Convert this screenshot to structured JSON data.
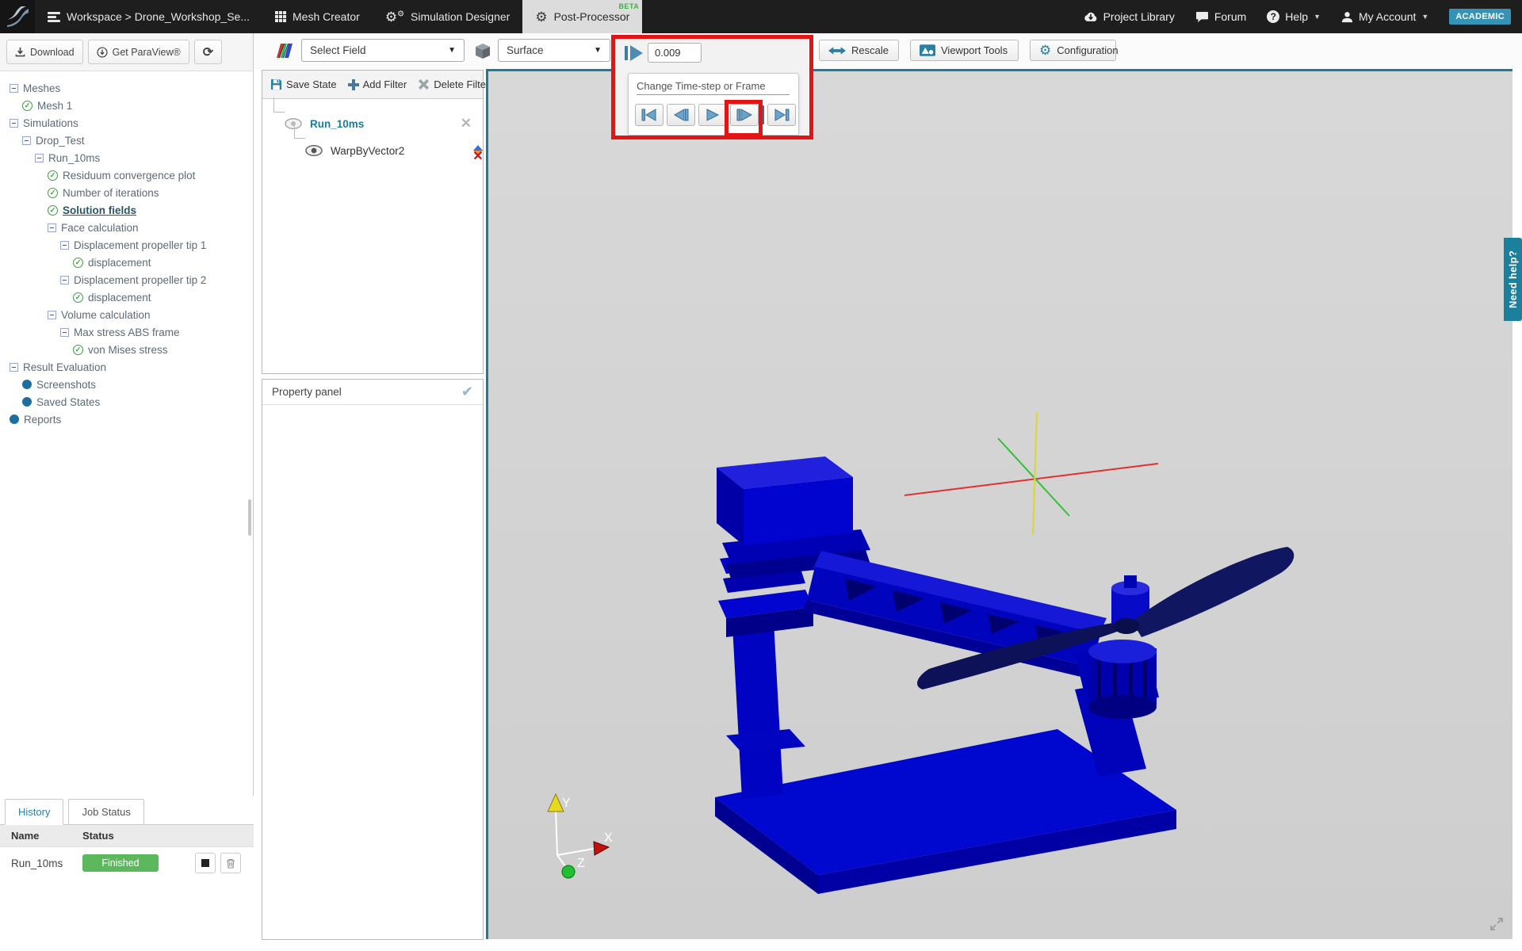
{
  "topbar": {
    "workspace_label": "Workspace > Drone_Workshop_Se...",
    "mesh_creator": "Mesh Creator",
    "simulation_designer": "Simulation Designer",
    "post_processor": "Post-Processor",
    "beta": "BETA",
    "project_library": "Project Library",
    "forum": "Forum",
    "help": "Help",
    "my_account": "My Account",
    "academic": "ACADEMIC"
  },
  "sidebar": {
    "download": "Download",
    "get_paraview": "Get ParaView®",
    "tree": [
      {
        "label": "Meshes"
      },
      {
        "label": "Mesh 1"
      },
      {
        "label": "Simulations"
      },
      {
        "label": "Drop_Test"
      },
      {
        "label": "Run_10ms"
      },
      {
        "label": "Residuum convergence plot"
      },
      {
        "label": "Number of iterations"
      },
      {
        "label": "Solution fields"
      },
      {
        "label": "Face calculation"
      },
      {
        "label": "Displacement propeller tip 1"
      },
      {
        "label": "displacement"
      },
      {
        "label": "Displacement propeller tip 2"
      },
      {
        "label": "displacement"
      },
      {
        "label": "Volume calculation"
      },
      {
        "label": "Max stress ABS frame"
      },
      {
        "label": "von Mises stress"
      },
      {
        "label": "Result Evaluation"
      },
      {
        "label": "Screenshots"
      },
      {
        "label": "Saved States"
      },
      {
        "label": "Reports"
      }
    ],
    "history": {
      "tab_history": "History",
      "tab_job_status": "Job Status",
      "col_name": "Name",
      "col_status": "Status",
      "run_name": "Run_10ms",
      "run_status": "Finished"
    }
  },
  "toolbar": {
    "select_field": "Select Field",
    "surface": "Surface",
    "time_value": "0.009",
    "rescale": "Rescale",
    "viewport_tools": "Viewport Tools",
    "configuration": "Configuration"
  },
  "time_popup": {
    "title": "Change Time-step or Frame"
  },
  "filter_panel": {
    "save_state": "Save State",
    "add_filter": "Add Filter",
    "delete_filter": "Delete Filter",
    "run_label": "Run_10ms",
    "filter_label": "WarpByVector2",
    "property_panel_title": "Property panel"
  },
  "viewport": {
    "need_help": "Need help?",
    "axis_x": "X",
    "axis_y": "Y",
    "axis_z": "Z"
  },
  "colors": {
    "accent_teal": "#1d7a99",
    "annotation_red": "#e31414",
    "finished_green": "#5cb85c",
    "academic_blue": "#3793b5",
    "beta_green": "#3fae49",
    "model_blue": "#0006c8"
  }
}
